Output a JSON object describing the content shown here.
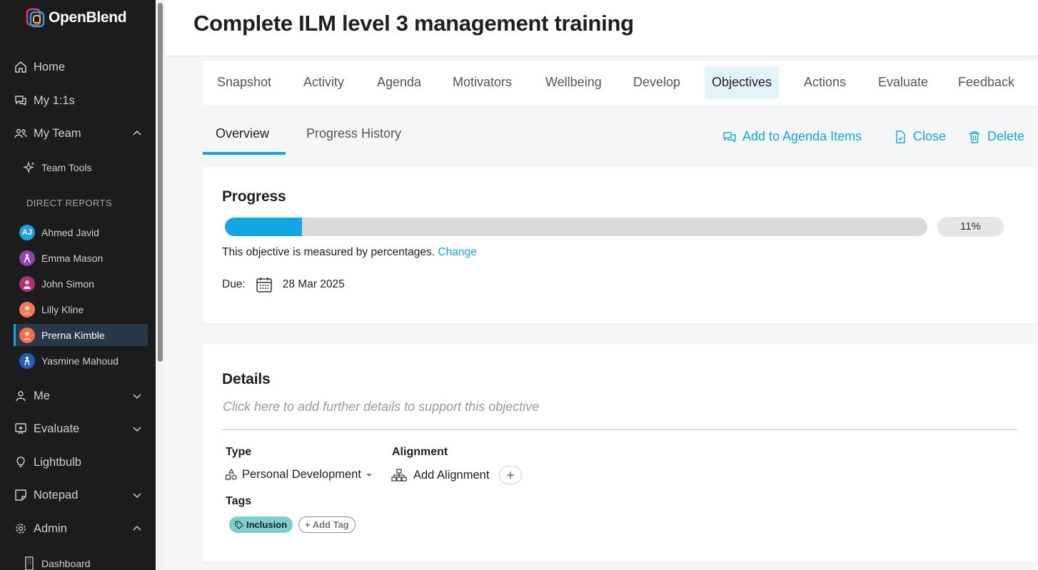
{
  "app": {
    "name": "OpenBlend"
  },
  "sidebar": {
    "nav": [
      {
        "label": "Home",
        "icon": "home-icon"
      },
      {
        "label": "My 1:1s",
        "icon": "chat-icon"
      },
      {
        "label": "My Team",
        "icon": "team-icon",
        "expanded": true
      },
      {
        "label": "Me",
        "icon": "person-icon",
        "expanded": false
      },
      {
        "label": "Evaluate",
        "icon": "evaluate-icon",
        "expanded": false
      },
      {
        "label": "Lightbulb",
        "icon": "lightbulb-icon"
      },
      {
        "label": "Notepad",
        "icon": "notepad-icon",
        "expanded": false
      },
      {
        "label": "Admin",
        "icon": "gear-icon",
        "expanded": true
      }
    ],
    "team_tools": "Team Tools",
    "direct_reports_label": "DIRECT REPORTS",
    "direct_reports": [
      {
        "name": "Ahmed Javid",
        "initials": "AJ",
        "color": "#1da1e0"
      },
      {
        "name": "Emma Mason",
        "color": "#8e44ad"
      },
      {
        "name": "John Simon",
        "color": "#b0307a"
      },
      {
        "name": "Lilly Kline",
        "color": "#f07a5a"
      },
      {
        "name": "Prerna Kimble",
        "color": "#f26b4f",
        "active": true
      },
      {
        "name": "Yasmine Mahoud",
        "color": "#1f5fb8"
      }
    ],
    "admin_sub": "Dashboard"
  },
  "page": {
    "title": "Complete ILM level 3 management training"
  },
  "tabs": [
    "Snapshot",
    "Activity",
    "Agenda",
    "Motivators",
    "Wellbeing",
    "Develop",
    "Objectives",
    "Actions",
    "Evaluate",
    "Feedback"
  ],
  "active_tab": "Objectives",
  "subtabs": [
    "Overview",
    "Progress History"
  ],
  "actions": {
    "add_agenda": "Add to Agenda Items",
    "close": "Close",
    "delete": "Delete"
  },
  "progress": {
    "heading": "Progress",
    "value": 0.11,
    "label": "11%",
    "measure_text": "This objective is measured by percentages.",
    "change_link": "Change",
    "due_label": "Due:",
    "due_date": "28 Mar 2025"
  },
  "details": {
    "heading": "Details",
    "placeholder": "Click here to add further details to support this objective",
    "type_label": "Type",
    "type_value": "Personal Development",
    "alignment_label": "Alignment",
    "alignment_value": "Add Alignment",
    "tags_label": "Tags",
    "tags": [
      "Inclusion"
    ],
    "add_tag": "+ Add Tag"
  },
  "colors": {
    "accent": "#12a7e3",
    "sidebar_bg": "#1c1c1c",
    "tag_bg": "#7ccfcc"
  }
}
